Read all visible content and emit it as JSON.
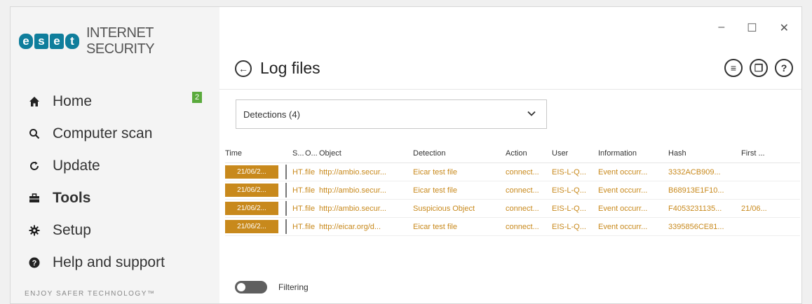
{
  "app": {
    "logo_letters": [
      "e",
      "s",
      "e",
      "t"
    ],
    "product_name": "INTERNET SECURITY",
    "tagline": "ENJOY SAFER TECHNOLOGY™"
  },
  "window_controls": {
    "minimize": "–",
    "maximize": "☐",
    "close": "✕"
  },
  "sidebar": {
    "items": [
      {
        "label": "Home",
        "icon": "home-icon",
        "glyph": "⌂",
        "badge": "2"
      },
      {
        "label": "Computer scan",
        "icon": "magnifier-icon",
        "glyph": "🔍"
      },
      {
        "label": "Update",
        "icon": "refresh-icon",
        "glyph": "↻"
      },
      {
        "label": "Tools",
        "icon": "briefcase-icon",
        "glyph": "▬",
        "active": true
      },
      {
        "label": "Setup",
        "icon": "gear-icon",
        "glyph": "✸"
      },
      {
        "label": "Help and support",
        "icon": "info-icon",
        "glyph": "●"
      }
    ]
  },
  "header": {
    "back_glyph": "←",
    "title": "Log files",
    "icons": [
      {
        "name": "list-view-icon",
        "glyph": "≡"
      },
      {
        "name": "copy-icon",
        "glyph": "❐"
      },
      {
        "name": "help-icon",
        "glyph": "?"
      }
    ]
  },
  "filter_dropdown": {
    "value": "Detections (4)",
    "chevron": "⌄"
  },
  "table": {
    "columns": [
      "Time",
      "S...",
      "O...",
      "Object",
      "Detection",
      "Action",
      "User",
      "Information",
      "Hash",
      "First ..."
    ],
    "rows": [
      [
        "21/06/2...",
        "HT...",
        "file",
        "http://ambio.secur...",
        "Eicar test file",
        "connect...",
        "EIS-L-Q...",
        "Event occurr...",
        "3332ACB909...",
        ""
      ],
      [
        "21/06/2...",
        "HT...",
        "file",
        "http://ambio.secur...",
        "Eicar test file",
        "connect...",
        "EIS-L-Q...",
        "Event occurr...",
        "B68913E1F10...",
        ""
      ],
      [
        "21/06/2...",
        "HT...",
        "file",
        "http://ambio.secur...",
        "Suspicious Object",
        "connect...",
        "EIS-L-Q...",
        "Event occurr...",
        "F4053231135...",
        "21/06..."
      ],
      [
        "21/06/2...",
        "HT...",
        "file",
        "http://eicar.org/d...",
        "Eicar test file",
        "connect...",
        "EIS-L-Q...",
        "Event occurr...",
        "3395856CE81...",
        ""
      ]
    ]
  },
  "filtering": {
    "label": "Filtering",
    "enabled": false
  },
  "colors": {
    "accent": "#c8891c",
    "brand": "#0f7e9c",
    "badge": "#5aaa3c"
  }
}
